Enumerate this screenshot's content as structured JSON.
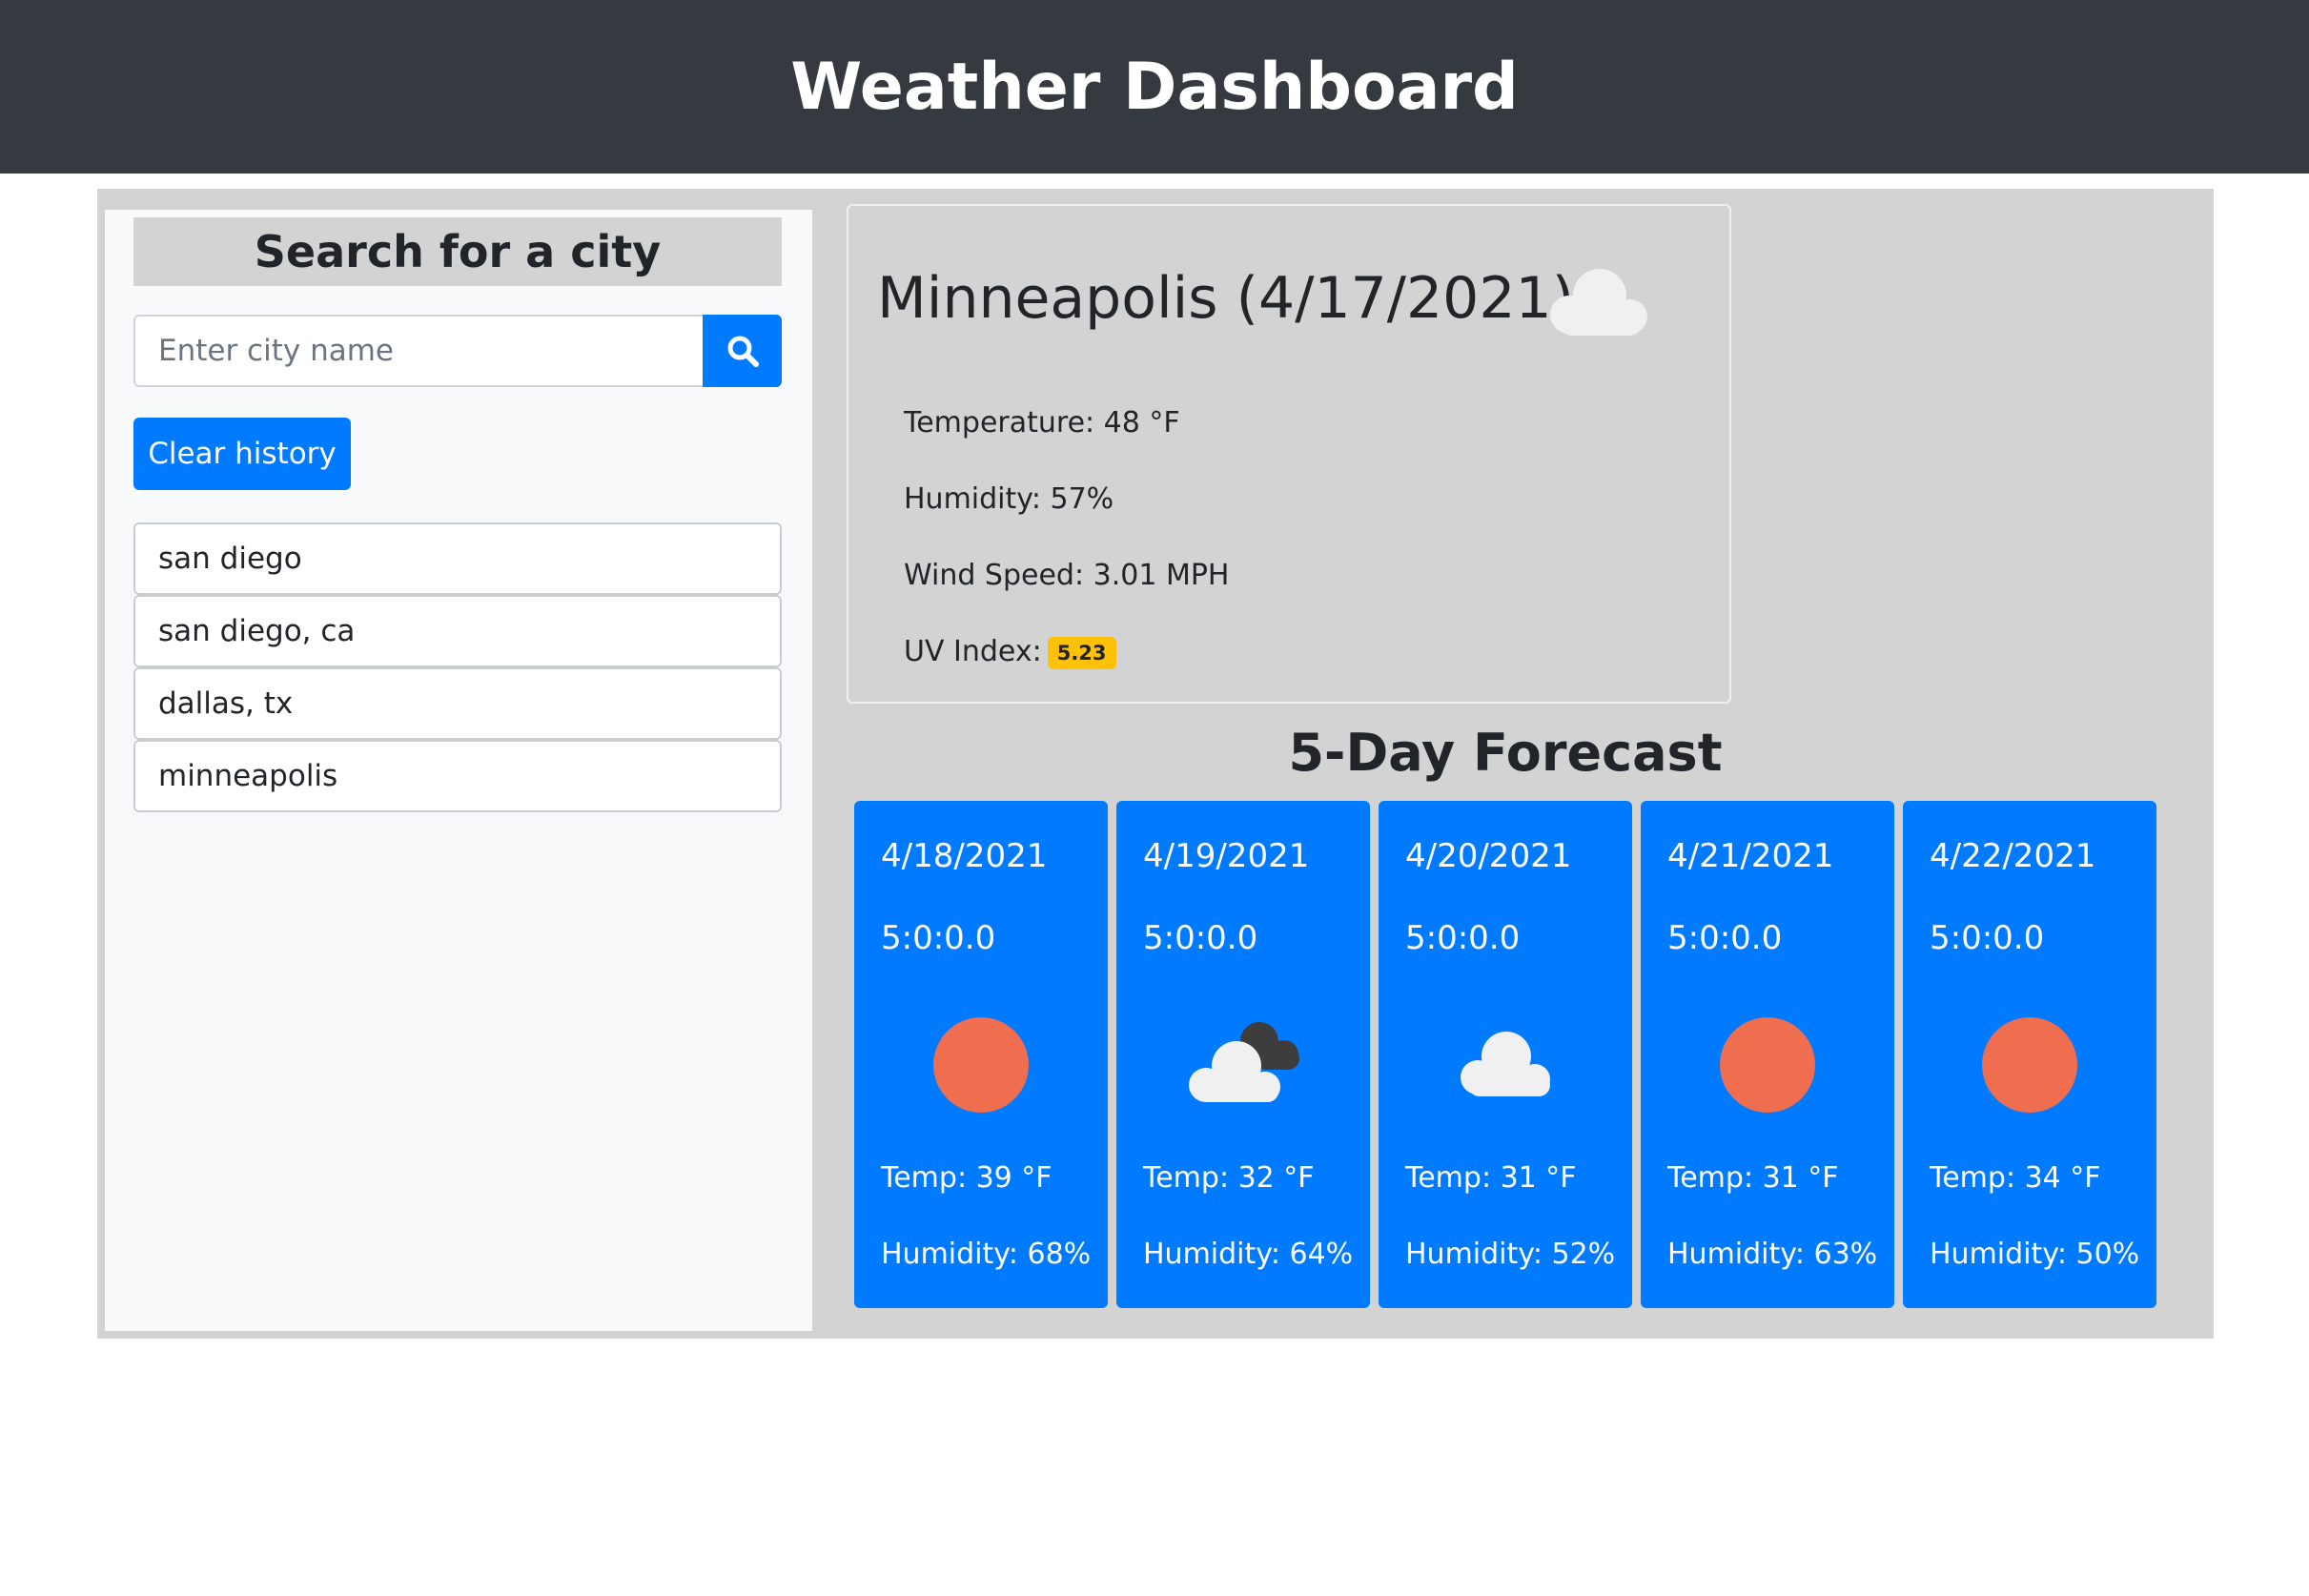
{
  "header": {
    "title": "Weather Dashboard"
  },
  "sidebar": {
    "title": "Search for a city",
    "search": {
      "placeholder": "Enter city name",
      "value": "",
      "icon": "search-icon"
    },
    "clear_label": "Clear history",
    "history": [
      "san diego",
      "san diego, ca",
      "dallas, tx",
      "minneapolis"
    ]
  },
  "current": {
    "title": "Minneapolis (4/17/2021)",
    "icon": "cloud-icon",
    "temperature": "Temperature: 48 °F",
    "humidity": "Humidity: 57%",
    "wind": "Wind Speed: 3.01 MPH",
    "uv_label": "UV Index:",
    "uv_value": "5.23",
    "uv_color": "#ffc107"
  },
  "forecast": {
    "title": "5-Day Forecast",
    "days": [
      {
        "date": "4/18/2021",
        "time": "5:0:0.0",
        "icon": "sun-icon",
        "temp": "Temp: 39 °F",
        "humidity": "Humidity: 68%"
      },
      {
        "date": "4/19/2021",
        "time": "5:0:0.0",
        "icon": "broken-clouds-icon",
        "temp": "Temp: 32 °F",
        "humidity": "Humidity: 64%"
      },
      {
        "date": "4/20/2021",
        "time": "5:0:0.0",
        "icon": "cloud-icon",
        "temp": "Temp: 31 °F",
        "humidity": "Humidity: 52%"
      },
      {
        "date": "4/21/2021",
        "time": "5:0:0.0",
        "icon": "sun-icon",
        "temp": "Temp: 31 °F",
        "humidity": "Humidity: 63%"
      },
      {
        "date": "4/22/2021",
        "time": "5:0:0.0",
        "icon": "sun-icon",
        "temp": "Temp: 34 °F",
        "humidity": "Humidity: 50%"
      }
    ]
  },
  "colors": {
    "navbar": "#343a40",
    "panel": "#d3d3d3",
    "primary": "#007bff",
    "sun": "#ee6e4f",
    "cloud": "#f0f0f0"
  }
}
